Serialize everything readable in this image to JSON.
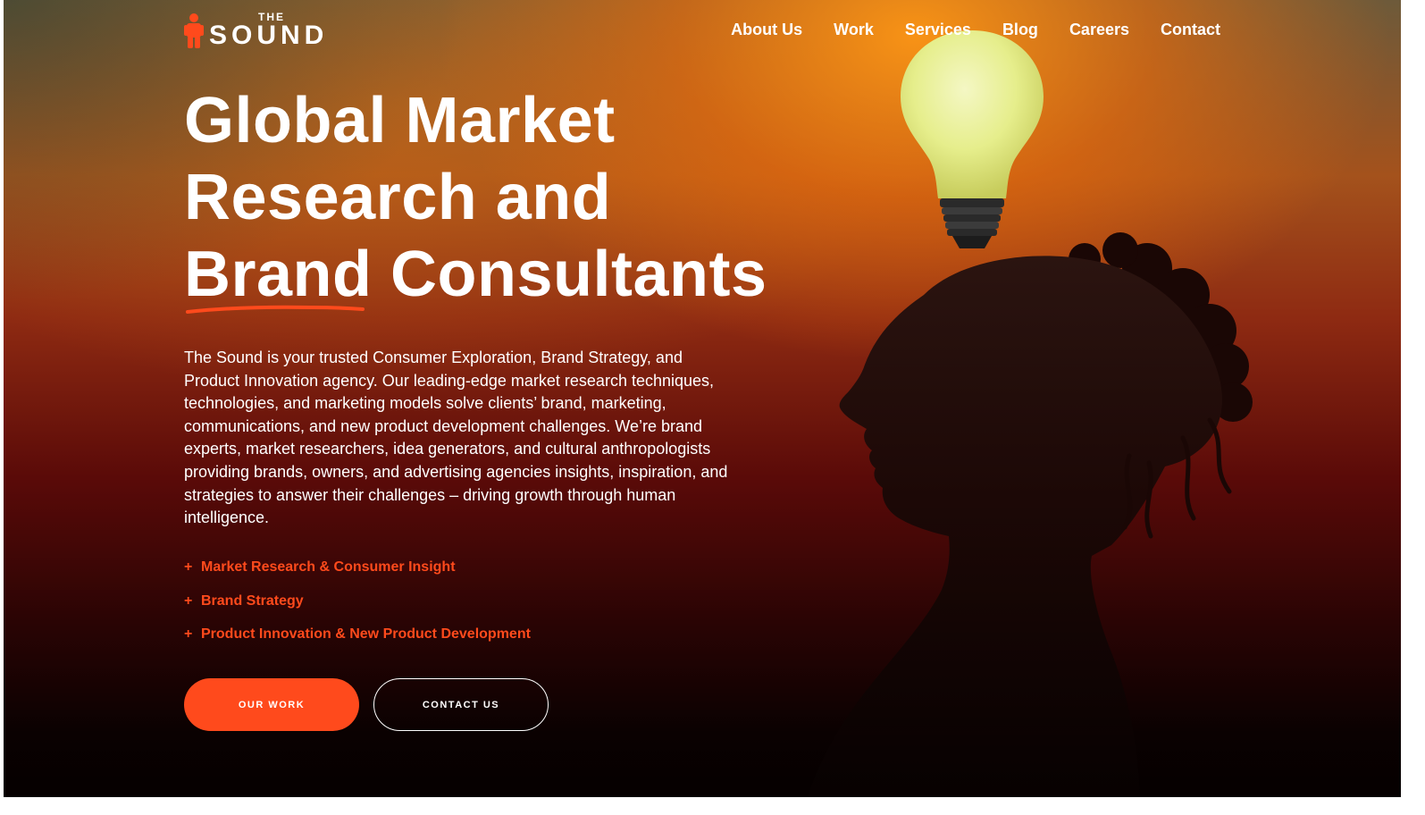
{
  "header": {
    "logo": {
      "the": "THE",
      "sound": "SOUND"
    },
    "nav": [
      {
        "label": "About Us"
      },
      {
        "label": "Work"
      },
      {
        "label": "Services"
      },
      {
        "label": "Blog"
      },
      {
        "label": "Careers"
      },
      {
        "label": "Contact"
      }
    ]
  },
  "hero": {
    "title_lines": [
      "Global Market",
      "Research and",
      "Brand Consultants"
    ],
    "description": "The Sound is your trusted Consumer Exploration, Brand Strategy, and Product Innovation agency. Our leading-edge market research techniques, technologies, and marketing models solve clients’ brand, marketing, communications, and new product development challenges. We’re brand experts, market researchers, idea generators, and cultural anthropologists providing brands, owners, and advertising agencies insights, inspiration, and strategies to answer their challenges – driving growth through human intelligence.",
    "services": [
      {
        "plus": "+",
        "label": "Market Research & Consumer Insight"
      },
      {
        "plus": "+",
        "label": "Brand Strategy"
      },
      {
        "plus": "+",
        "label": "Product Innovation & New Product Development"
      }
    ],
    "buttons": {
      "primary": "OUR WORK",
      "secondary": "CONTACT US"
    }
  },
  "colors": {
    "accent": "#ff4a1c",
    "text": "#ffffff"
  },
  "icons": {
    "logo_mark": "figure-logo-icon",
    "bulb": "lightbulb-illustration",
    "silhouette": "woman-silhouette-illustration"
  }
}
